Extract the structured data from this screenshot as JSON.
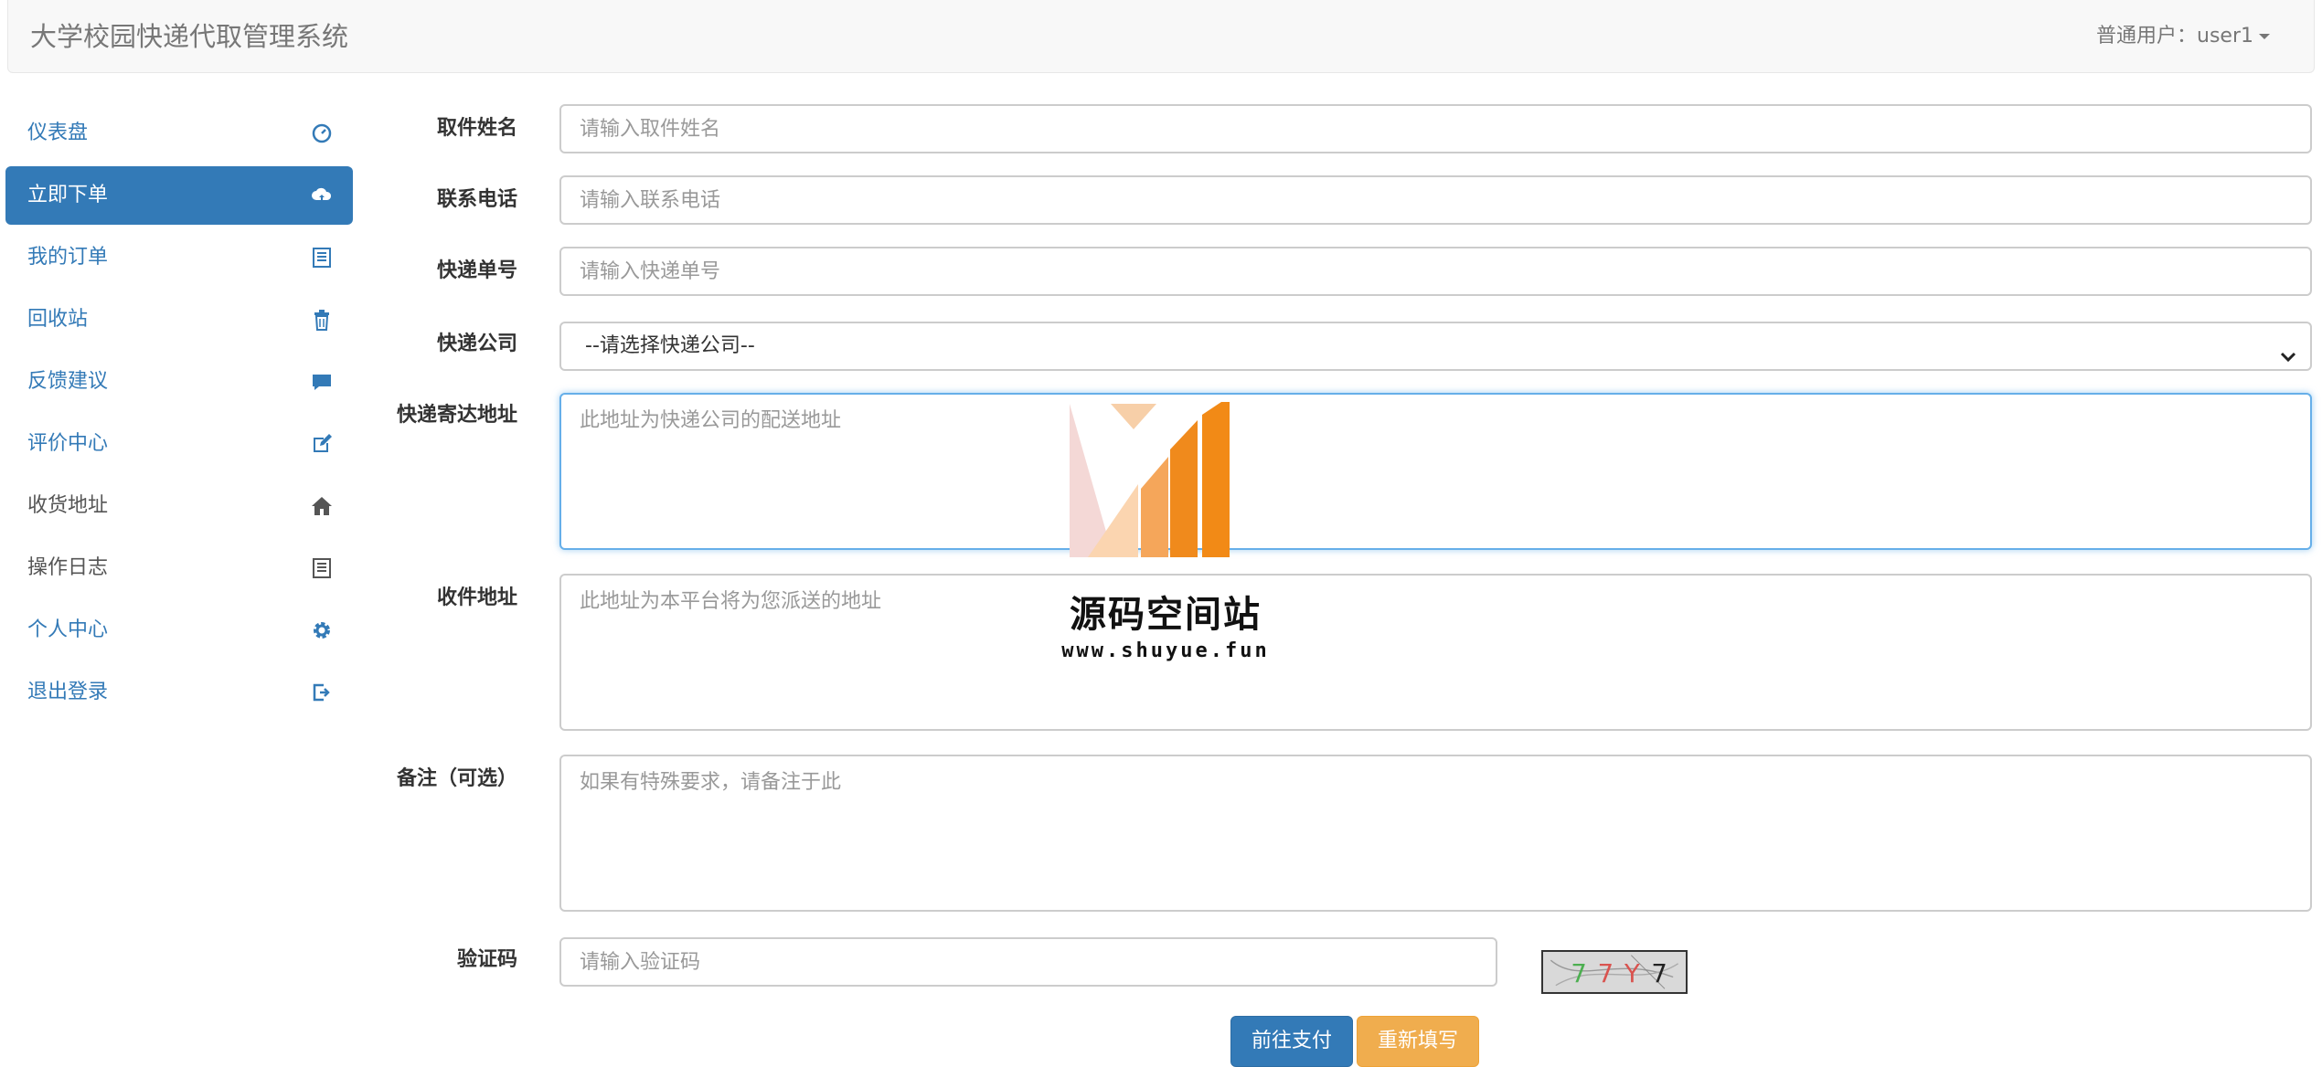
{
  "header": {
    "title": "大学校园快递代取管理系统",
    "user_label": "普通用户：user1"
  },
  "sidebar": {
    "items": [
      {
        "label": "仪表盘",
        "icon": "dashboard-icon"
      },
      {
        "label": "立即下单",
        "icon": "cloud-upload-icon"
      },
      {
        "label": "我的订单",
        "icon": "list-icon"
      },
      {
        "label": "回收站",
        "icon": "trash-icon"
      },
      {
        "label": "反馈建议",
        "icon": "comment-icon"
      },
      {
        "label": "评价中心",
        "icon": "edit-icon"
      },
      {
        "label": "收货地址",
        "icon": "home-icon"
      },
      {
        "label": "操作日志",
        "icon": "log-icon"
      },
      {
        "label": "个人中心",
        "icon": "gear-icon"
      },
      {
        "label": "退出登录",
        "icon": "logout-icon"
      }
    ]
  },
  "form": {
    "name_label": "取件姓名",
    "name_placeholder": "请输入取件姓名",
    "phone_label": "联系电话",
    "phone_placeholder": "请输入联系电话",
    "tracking_label": "快递单号",
    "tracking_placeholder": "请输入快递单号",
    "company_label": "快递公司",
    "company_selected": "--请选择快递公司--",
    "send_address_label": "快递寄达地址",
    "send_address_placeholder": "此地址为快递公司的配送地址",
    "recv_address_label": "收件地址",
    "recv_address_placeholder": "此地址为本平台将为您派送的地址",
    "remark_label": "备注（可选）",
    "remark_placeholder": "如果有特殊要求，请备注于此",
    "captcha_label": "验证码",
    "captcha_placeholder": "请输入验证码",
    "captcha_text": "77Y7",
    "submit_label": "前往支付",
    "reset_label": "重新填写"
  },
  "watermark": {
    "title": "源码空间站",
    "url": "www.shuyue.fun"
  },
  "colors": {
    "primary": "#337ab7",
    "warning": "#f0ad4e",
    "link": "#337ab7"
  }
}
